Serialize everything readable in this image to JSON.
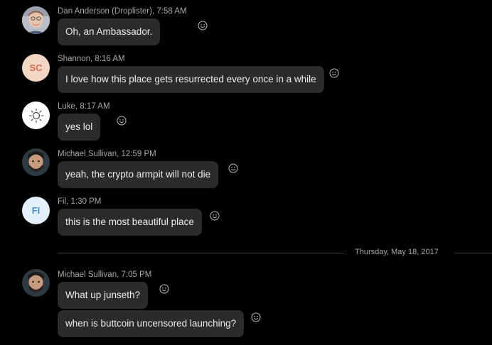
{
  "messages": [
    {
      "author": "Dan Anderson (Droplister)",
      "time": "7:58 AM",
      "meta": "Dan Anderson (Droplister), 7:58 AM",
      "text": "Oh, an Ambassador."
    },
    {
      "author": "Shannon",
      "time": "8:16 AM",
      "meta": "Shannon, 8:16 AM",
      "initials": "SC",
      "text": "I love how this place gets resurrected every once in a while"
    },
    {
      "author": "Luke",
      "time": "8:17 AM",
      "meta": "Luke, 8:17 AM",
      "text": "yes lol"
    },
    {
      "author": "Michael Sullivan",
      "time": "12:59 PM",
      "meta": "Michael Sullivan, 12:59 PM",
      "text": "yeah, the crypto armpit will not die"
    },
    {
      "author": "Fil",
      "time": "1:30 PM",
      "meta": "Fil, 1:30 PM",
      "initials": "FI",
      "text": "this is the most beautiful place"
    },
    {
      "author": "Michael Sullivan",
      "time": "7:05 PM",
      "meta": "Michael Sullivan, 7:05 PM",
      "text": "What up junseth?",
      "text2": "when is buttcoin uncensored launching?"
    }
  ],
  "date_separator": "Thursday, May 18, 2017",
  "icons": {
    "react": "smiley-react-icon"
  },
  "colors": {
    "background": "#000000",
    "bubble": "#2b2b2b",
    "meta": "#a8a8a8"
  }
}
